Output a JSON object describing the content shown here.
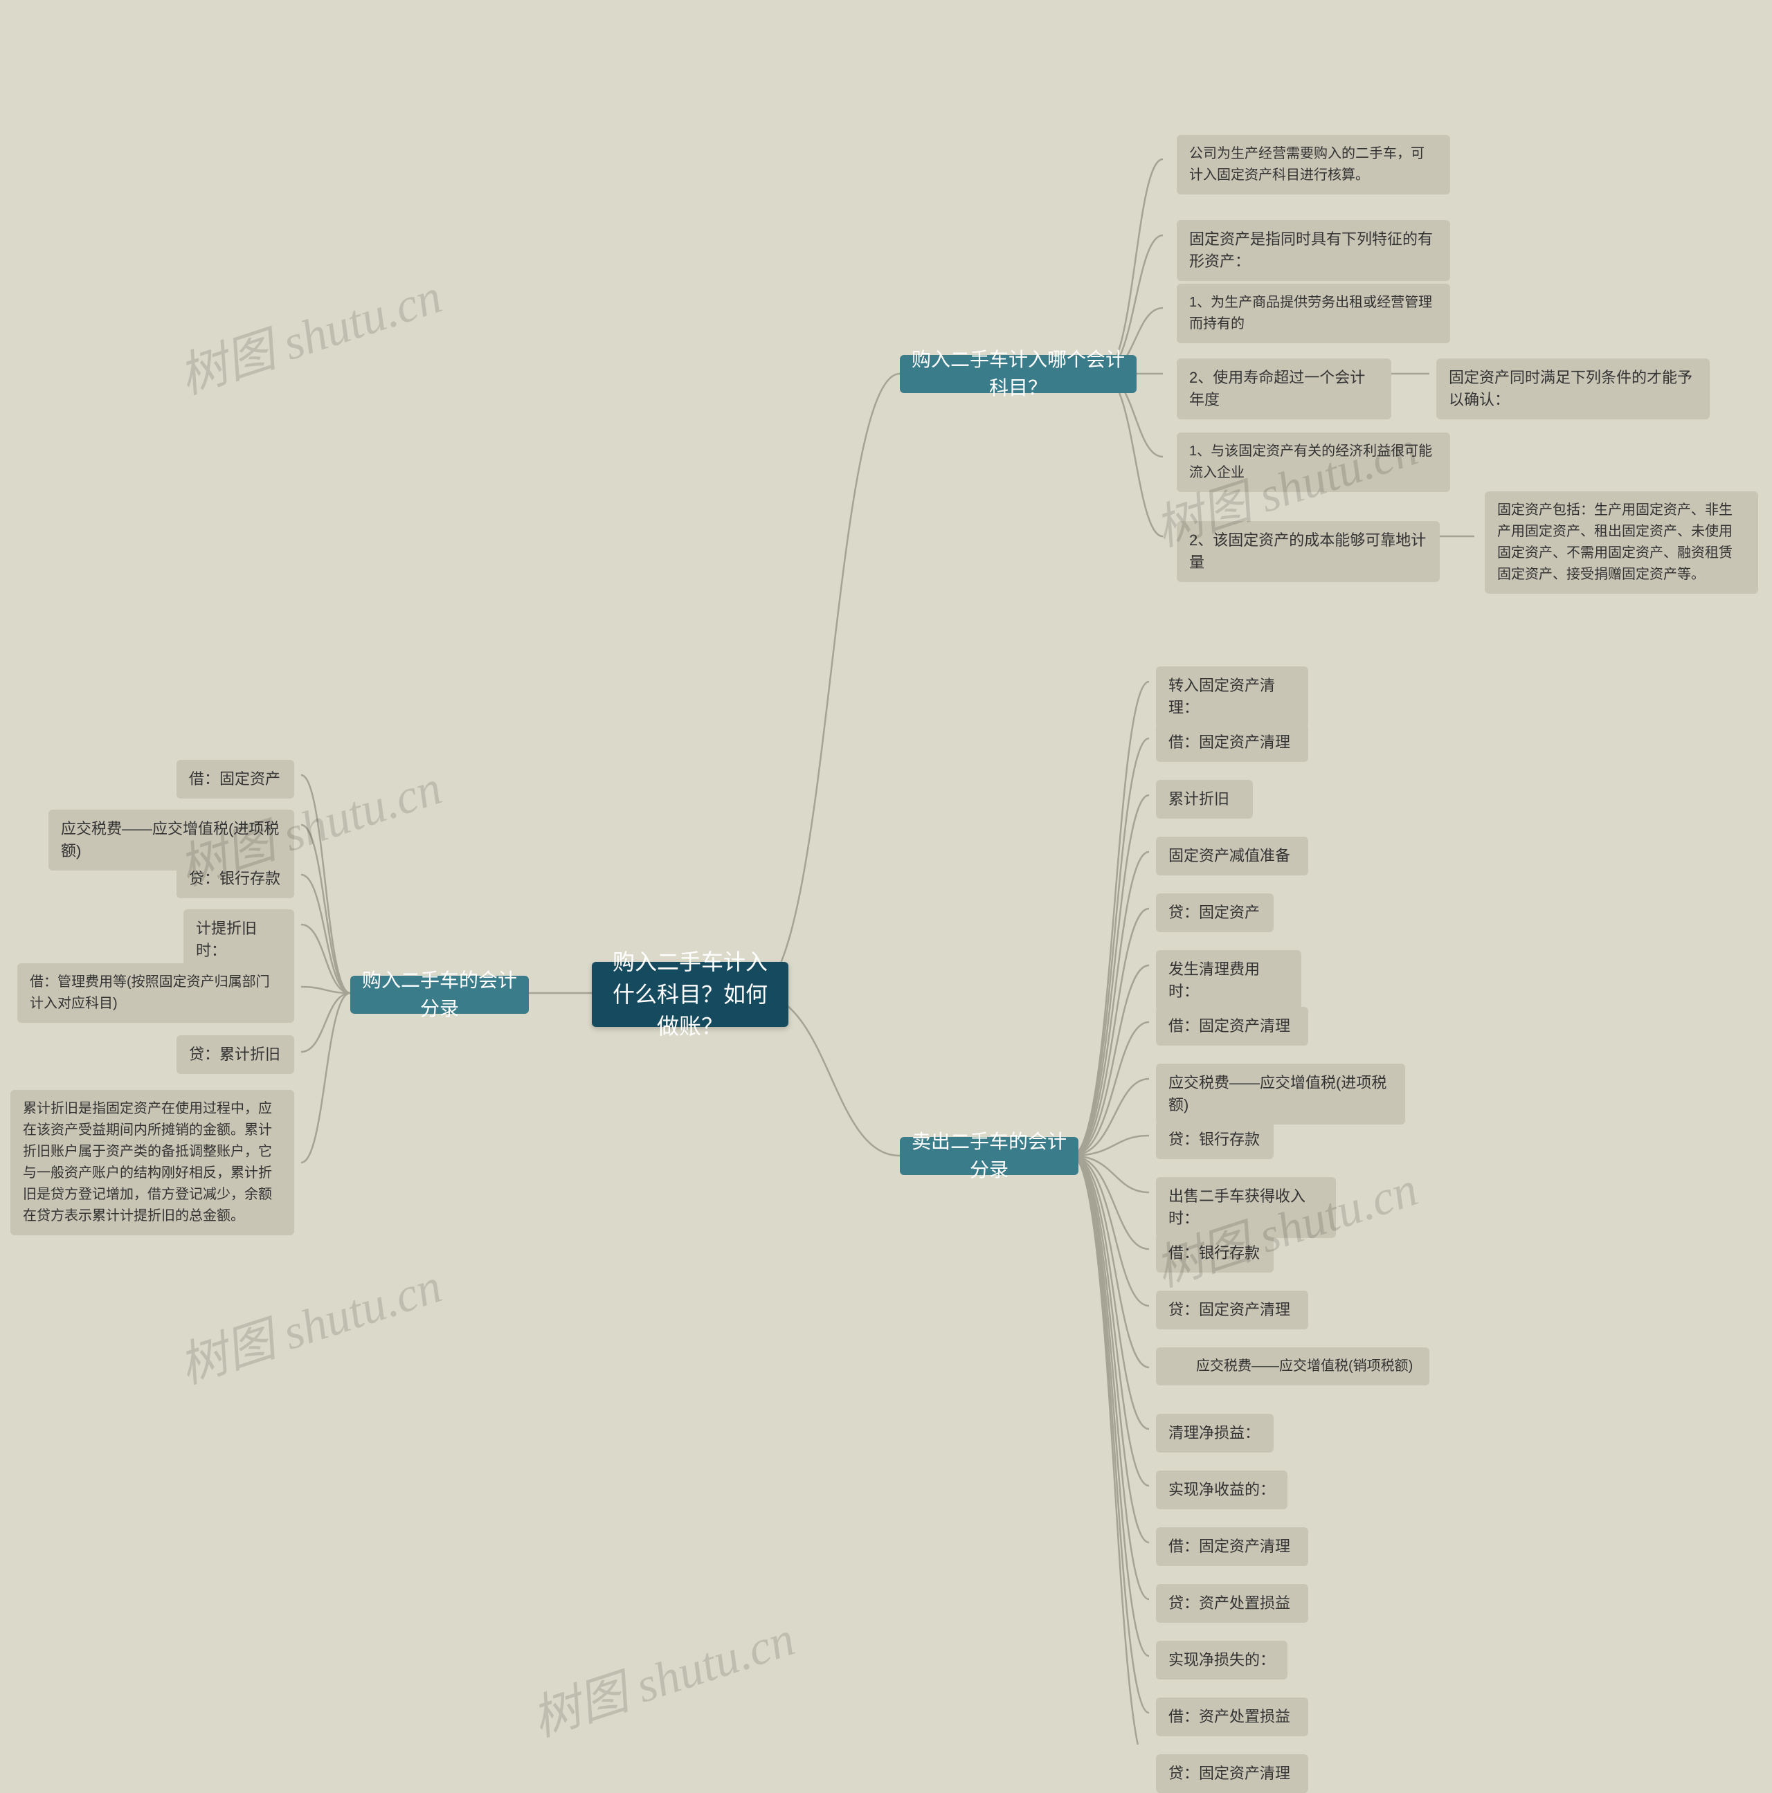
{
  "watermark": "树图 shutu.cn",
  "root": {
    "title": "购入二手车计入什么科目？如何做账？"
  },
  "left": {
    "title": "购入二手车的会计分录",
    "items": [
      "借：固定资产",
      "应交税费——应交增值税(进项税额)",
      "贷：银行存款",
      "计提折旧时：",
      "借：管理费用等(按照固定资产归属部门计入对应科目)",
      "贷：累计折旧",
      "累计折旧是指固定资产在使用过程中，应在该资产受益期间内所摊销的金额。累计折旧账户属于资产类的备抵调整账户，它与一般资产账户的结构刚好相反，累计折旧是贷方登记增加，借方登记减少，余额在贷方表示累计计提折旧的总金额。"
    ]
  },
  "right1": {
    "title": "购入二手车计入哪个会计科目？",
    "items": [
      "公司为生产经营需要购入的二手车，可计入固定资产科目进行核算。",
      "固定资产是指同时具有下列特征的有形资产：",
      "1、为生产商品提供劳务出租或经营管理而持有的",
      "2、使用寿命超过一个会计年度",
      "1、与该固定资产有关的经济利益很可能流入企业",
      "2、该固定资产的成本能够可靠地计量"
    ],
    "sub1": "固定资产同时满足下列条件的才能予以确认：",
    "sub2": "固定资产包括：生产用固定资产、非生产用固定资产、租出固定资产、未使用固定资产、不需用固定资产、融资租赁固定资产、接受捐赠固定资产等。"
  },
  "right2": {
    "title": "卖出二手车的会计分录",
    "items": [
      "转入固定资产清理：",
      "借：固定资产清理",
      "累计折旧",
      "固定资产减值准备",
      "贷：固定资产",
      "发生清理费用时：",
      "借：固定资产清理",
      "应交税费——应交增值税(进项税额)",
      "贷：银行存款",
      "出售二手车获得收入时：",
      "借：银行存款",
      "贷：固定资产清理",
      "　　应交税费——应交增值税(销项税额)",
      "清理净损益：",
      "实现净收益的：",
      "借：固定资产清理",
      "贷：资产处置损益",
      "实现净损失的：",
      "借：资产处置损益",
      "贷：固定资产清理"
    ]
  }
}
